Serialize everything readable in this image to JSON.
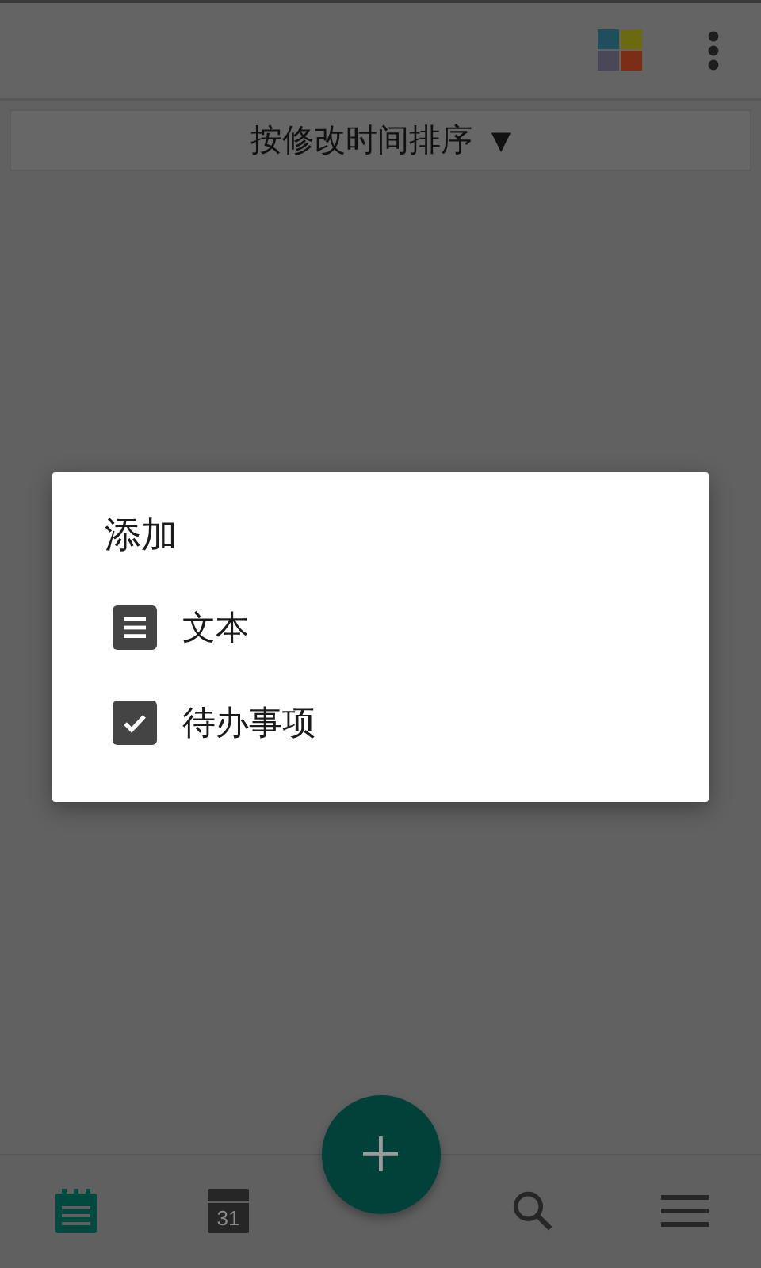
{
  "sort": {
    "label": "按修改时间排序",
    "arrow": "▼"
  },
  "dialog": {
    "title": "添加",
    "items": [
      {
        "kind": "text",
        "label": "文本"
      },
      {
        "kind": "todo",
        "label": "待办事项"
      }
    ]
  },
  "bottom_nav": {
    "tabs": [
      {
        "kind": "notes",
        "selected": true
      },
      {
        "kind": "calendar",
        "day": "31",
        "selected": false
      },
      {
        "kind": "search",
        "selected": false
      },
      {
        "kind": "menu",
        "selected": false
      }
    ]
  }
}
